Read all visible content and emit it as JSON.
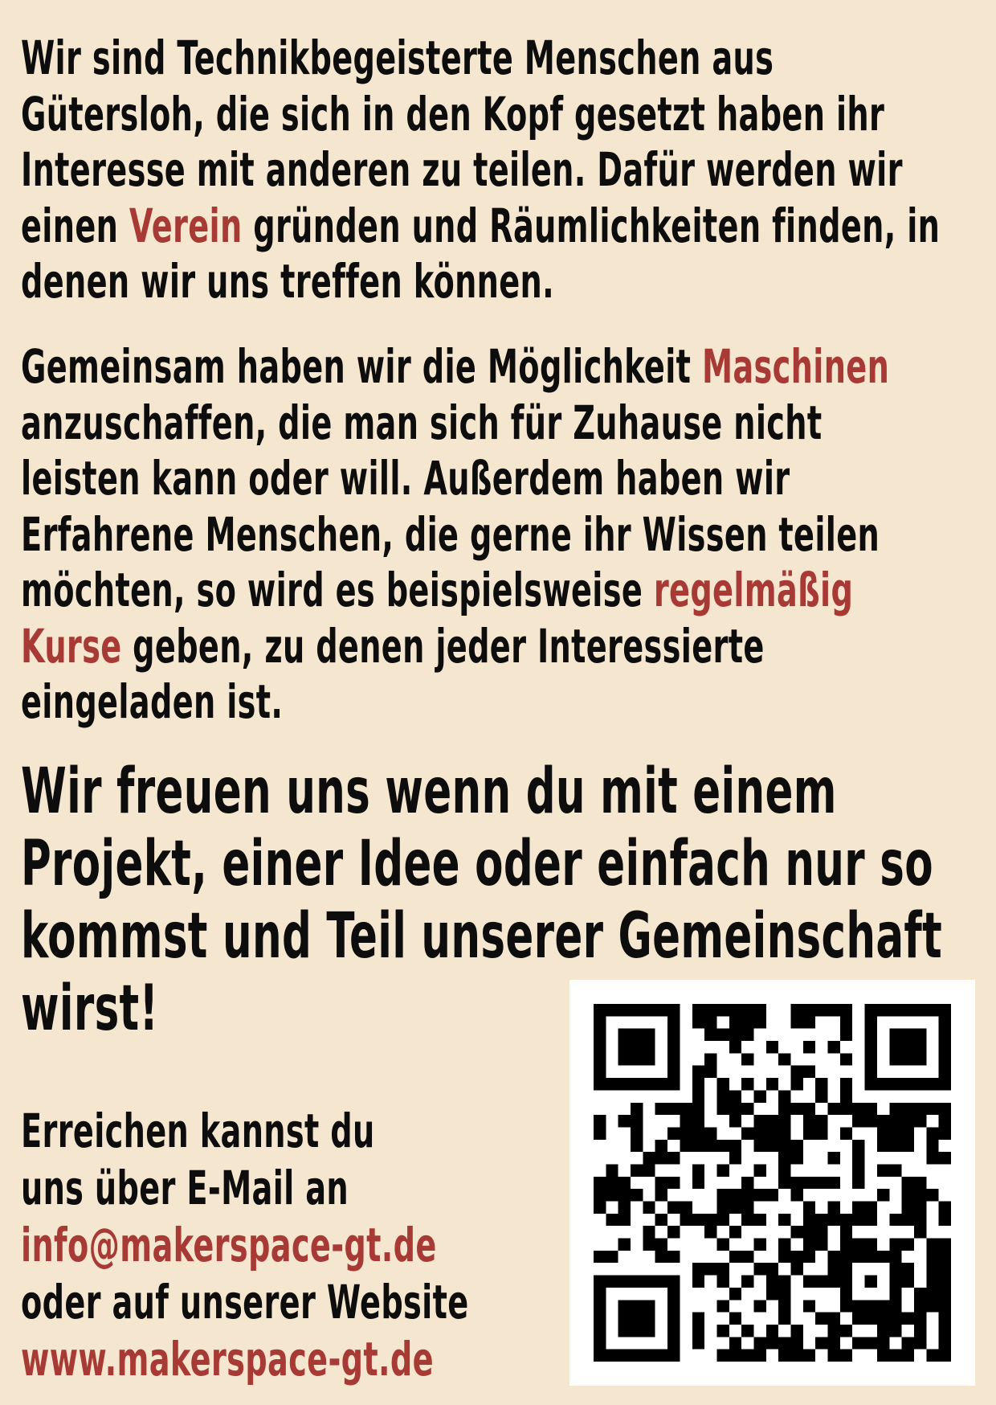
{
  "intro": {
    "lines": [
      [
        "Wir sind Technikbegeisterte Menschen aus"
      ],
      [
        "Gütersloh, die sich in den Kopf gesetzt haben ihr"
      ],
      [
        "Interesse mit anderen zu teilen. Dafür werden wir"
      ],
      [
        "einen ",
        "Verein",
        " gründen und Räumlichkeiten finden, in"
      ],
      [
        "denen wir uns treffen können."
      ]
    ]
  },
  "offer": {
    "lines": [
      [
        "Gemeinsam haben wir die Möglichkeit ",
        "Maschinen"
      ],
      [
        "anzuschaffen, die man sich für Zuhause nicht"
      ],
      [
        "leisten kann oder will. Außerdem haben wir"
      ],
      [
        "Erfahrene Menschen, die gerne ihr Wissen teilen"
      ],
      [
        "möchten, so wird es beispielsweise ",
        "regelmäßig"
      ],
      [
        "Kurse",
        " geben, zu denen jeder Interessierte"
      ],
      [
        "eingeladen ist."
      ]
    ]
  },
  "invitation": {
    "lines": [
      "Wir freuen uns wenn du mit einem",
      "Projekt, einer Idee oder einfach nur so",
      "kommst und Teil unserer Gemeinschaft",
      "wirst!"
    ]
  },
  "contact": {
    "line1": "Erreichen kannst du",
    "line2": "uns über E-Mail an",
    "email": "info@makerspace-gt.de",
    "line3": "oder auf unserer Website",
    "website": "www.makerspace-gt.de"
  },
  "colors": {
    "background": "#f5e6cf",
    "text": "#0d0d0d",
    "accent": "#a83a36"
  },
  "qr_code": {
    "icon": "qr-code-icon"
  }
}
